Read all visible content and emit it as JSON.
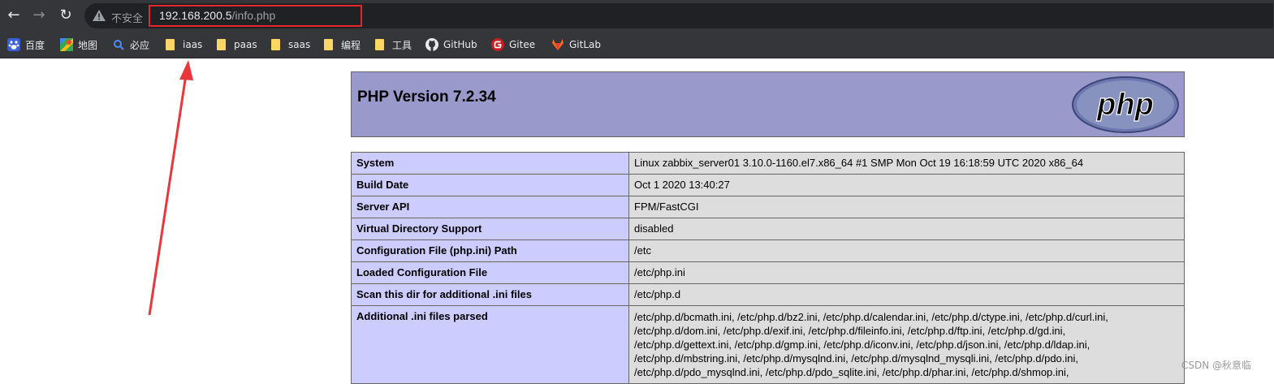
{
  "browser": {
    "back_icon": "←",
    "forward_icon": "→",
    "reload_icon": "↻",
    "security_label": "不安全",
    "url_host": "192.168.200.5",
    "url_path": "/info.php"
  },
  "bookmarks": [
    {
      "label": "百度",
      "icon": "baidu-icon"
    },
    {
      "label": "地图",
      "icon": "maps-icon"
    },
    {
      "label": "必应",
      "icon": "bing-icon"
    },
    {
      "label": "iaas",
      "icon": "folder-icon"
    },
    {
      "label": "paas",
      "icon": "folder-icon"
    },
    {
      "label": "saas",
      "icon": "folder-icon"
    },
    {
      "label": "编程",
      "icon": "folder-icon"
    },
    {
      "label": "工具",
      "icon": "folder-icon"
    },
    {
      "label": "GitHub",
      "icon": "github-icon"
    },
    {
      "label": "Gitee",
      "icon": "gitee-icon"
    },
    {
      "label": "GitLab",
      "icon": "gitlab-icon"
    }
  ],
  "php": {
    "title": "PHP Version 7.2.34",
    "logo_text": "php",
    "rows": [
      {
        "key": "System",
        "value": "Linux zabbix_server01 3.10.0-1160.el7.x86_64 #1 SMP Mon Oct 19 16:18:59 UTC 2020 x86_64"
      },
      {
        "key": "Build Date",
        "value": "Oct 1 2020 13:40:27"
      },
      {
        "key": "Server API",
        "value": "FPM/FastCGI"
      },
      {
        "key": "Virtual Directory Support",
        "value": "disabled"
      },
      {
        "key": "Configuration File (php.ini) Path",
        "value": "/etc"
      },
      {
        "key": "Loaded Configuration File",
        "value": "/etc/php.ini"
      },
      {
        "key": "Scan this dir for additional .ini files",
        "value": "/etc/php.d"
      },
      {
        "key": "Additional .ini files parsed",
        "value_lines": [
          "/etc/php.d/bcmath.ini, /etc/php.d/bz2.ini, /etc/php.d/calendar.ini, /etc/php.d/ctype.ini, /etc/php.d/curl.ini,",
          "/etc/php.d/dom.ini, /etc/php.d/exif.ini, /etc/php.d/fileinfo.ini, /etc/php.d/ftp.ini, /etc/php.d/gd.ini,",
          "/etc/php.d/gettext.ini, /etc/php.d/gmp.ini, /etc/php.d/iconv.ini, /etc/php.d/json.ini, /etc/php.d/ldap.ini,",
          "/etc/php.d/mbstring.ini, /etc/php.d/mysqlnd.ini, /etc/php.d/mysqlnd_mysqli.ini, /etc/php.d/pdo.ini,",
          "/etc/php.d/pdo_mysqlnd.ini, /etc/php.d/pdo_sqlite.ini, /etc/php.d/phar.ini, /etc/php.d/shmop.ini,"
        ]
      }
    ]
  },
  "watermark": "CSDN @秋意临",
  "colors": {
    "highlight": "#e0272c",
    "php_header": "#9999cc",
    "key_cell": "#ccccff",
    "value_cell": "#dddddd"
  }
}
